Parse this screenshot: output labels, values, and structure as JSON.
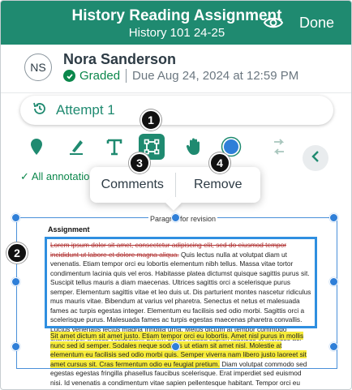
{
  "header": {
    "title": "History Reading Assignment",
    "subtitle": "History 101 24-25",
    "done_label": "Done"
  },
  "student": {
    "initials": "NS",
    "name": "Nora Sanderson",
    "status": "Graded",
    "due": "Due Aug 24, 2024 at 12:59 PM"
  },
  "attempt": {
    "label": "Attempt 1"
  },
  "toolbar": {
    "tools": [
      "pin-icon",
      "highlighter-icon",
      "text-icon",
      "box-select-icon",
      "hand-icon",
      "color-dot-icon",
      "redo-icon"
    ],
    "active_color": "#2f7fd8"
  },
  "annotations_filter": "All annotatio",
  "popup": {
    "comments_label": "Comments",
    "remove_label": "Remove"
  },
  "callouts": [
    "1",
    "2",
    "3",
    "4"
  ],
  "document": {
    "paragraph_label": "Paragr   1 for revision",
    "heading": "Assignment",
    "strike_text": "Lorem ipsum dolor sit amet, consectetur adipiscing elit, sed do eiusmod tempor incididunt ut labore et dolore magna aliqua.",
    "body_text": " Quis lectus nulla at volutpat diam ut venenatis. Etiam tempor orci eu lobortis elementum nibh tellus. Massa vitae tortor condimentum lacinia quis vel eros. Habitasse platea dictumst quisque sagittis purus sit. Suscipit tellus mauris a diam maecenas. Ultrices sagittis orci a scelerisque purus semper. Elementum sagittis vitae et leo duis ut. Dis parturient montes nascetur ridiculus mus mauris vitae. Bibendum at varius vel pharetra. Senectus et netus et malesuada fames ac turpis egestas integer. Elementum eu facilisis sed odio morbi. Sagittis orci a scelerisque purus. Malesuada fames ac turpis egestas maecenas pharetra convallis. Luctus venenatis lectus magna fringilla urna. Metus dictum at tempor commodo ullamcorper a lacus vestibulum. Lorem donec massa sapien faucibus et molestie ac.",
    "highlight_text": "Sit amet dictum sit amet justo. Etiam tempor orci eu lobortis. Amet nisl purus in mollis nunc sed id semper. Sodales neque sodales ut etiam sit amet nisl. Molestie at elementum eu facilisis sed odio morbi quis. Semper viverra nam libero justo laoreet sit amet cursus sit. Cras fermentum odio eu feugiat pretium.",
    "tail_text": " Diam volutpat commodo sed egestas egestas fringilla phasellus faucibus scelerisque. Erat imperdiet sed euismod nisi. Id venenatis a condimentum vitae sapien pellentesque habitant. Tempor orci eu lobortis elementum nibh. Netus et malesuada fames ac."
  },
  "colors": {
    "brand": "#1f8a70",
    "graded": "#0b874b",
    "selection": "#2f8fe0",
    "highlight": "#f7ec3a"
  }
}
